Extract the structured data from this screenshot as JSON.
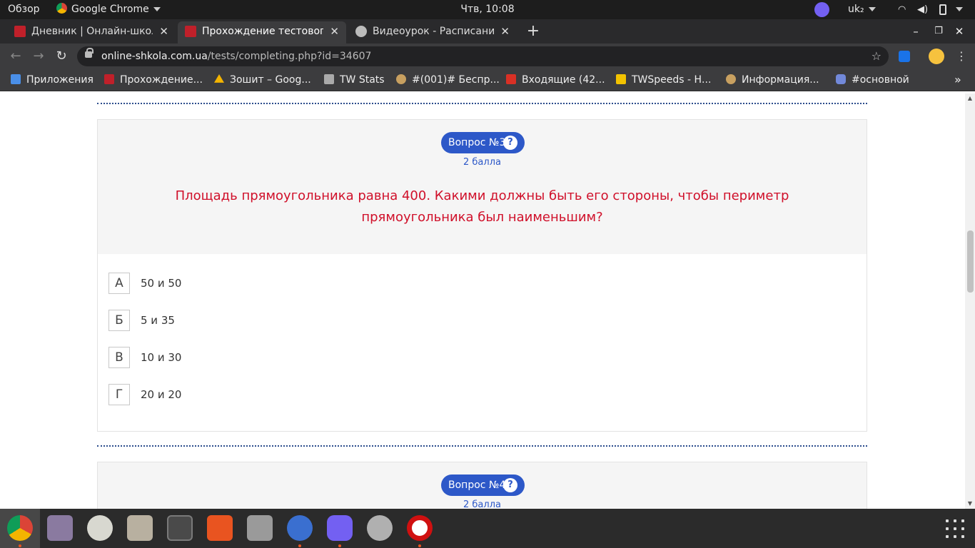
{
  "top_panel": {
    "activities": "Обзор",
    "app_name": "Google Chrome",
    "clock": "Чтв, 10:08",
    "keyboard_layout": "uk₂"
  },
  "tabs": [
    {
      "title": "Дневник | Онлайн-школа",
      "active": false
    },
    {
      "title": "Прохождение тестового",
      "active": true
    },
    {
      "title": "Видеоурок - Расписание",
      "active": false
    }
  ],
  "new_tab_label": "+",
  "omnibox": {
    "host": "online-shkola.com.ua",
    "path": "/tests/completing.php?id=34607"
  },
  "bookmarks": [
    {
      "label": "Приложения",
      "icon": "apps-grid-icon",
      "color": "#4a8fe8"
    },
    {
      "label": "Прохождение...",
      "icon": "school-favicon",
      "color": "#c0202a"
    },
    {
      "label": "Зошит – Goog...",
      "icon": "google-drive-icon",
      "color": "#f4b400"
    },
    {
      "label": "TW Stats",
      "icon": "tw-stats-icon",
      "color": "#aaaaaa"
    },
    {
      "label": "#(001)# Беспр...",
      "icon": "tribal-wars-icon",
      "color": "#c8a060"
    },
    {
      "label": "Входящие (42...",
      "icon": "gmail-icon",
      "color": "#d93025"
    },
    {
      "label": "TWSpeeds - Н...",
      "icon": "crown-icon",
      "color": "#f2c200"
    },
    {
      "label": "Информация...",
      "icon": "tribal-wars-icon",
      "color": "#c8a060"
    },
    {
      "label": "#основной",
      "icon": "discord-icon",
      "color": "#7289da"
    }
  ],
  "bookmarks_overflow": "»",
  "questions": [
    {
      "badge": "Вопрос №3",
      "help": "?",
      "points": "2 балла",
      "text": "Площадь прямоугольника равна 400. Какими должны быть его стороны, чтобы периметр прямоугольника был наименьшим?",
      "answers": [
        {
          "letter": "А",
          "text": "50 и 50"
        },
        {
          "letter": "Б",
          "text": "5 и 35"
        },
        {
          "letter": "В",
          "text": "10 и 30"
        },
        {
          "letter": "Г",
          "text": "20 и 20"
        }
      ]
    },
    {
      "badge": "Вопрос №4",
      "help": "?",
      "points": "2 балла"
    }
  ],
  "dock": [
    {
      "name": "chrome",
      "color": "#e0a020",
      "active": true,
      "running": true
    },
    {
      "name": "image-viewer",
      "color": "#8a7aa0",
      "active": false,
      "running": false
    },
    {
      "name": "audio-player",
      "color": "#d8d8d0",
      "active": false,
      "running": false
    },
    {
      "name": "files",
      "color": "#b8b0a0",
      "active": false,
      "running": false
    },
    {
      "name": "calculator",
      "color": "#4a4a4a",
      "active": false,
      "running": false
    },
    {
      "name": "software-center",
      "color": "#e95420",
      "active": false,
      "running": false
    },
    {
      "name": "camera",
      "color": "#9a9a9a",
      "active": false,
      "running": false
    },
    {
      "name": "chromium",
      "color": "#3a6fd0",
      "active": false,
      "running": true
    },
    {
      "name": "viber",
      "color": "#7360f2",
      "active": false,
      "running": true
    },
    {
      "name": "settings",
      "color": "#b0b0b0",
      "active": false,
      "running": false
    },
    {
      "name": "opera",
      "color": "#d01010",
      "active": false,
      "running": true
    }
  ]
}
